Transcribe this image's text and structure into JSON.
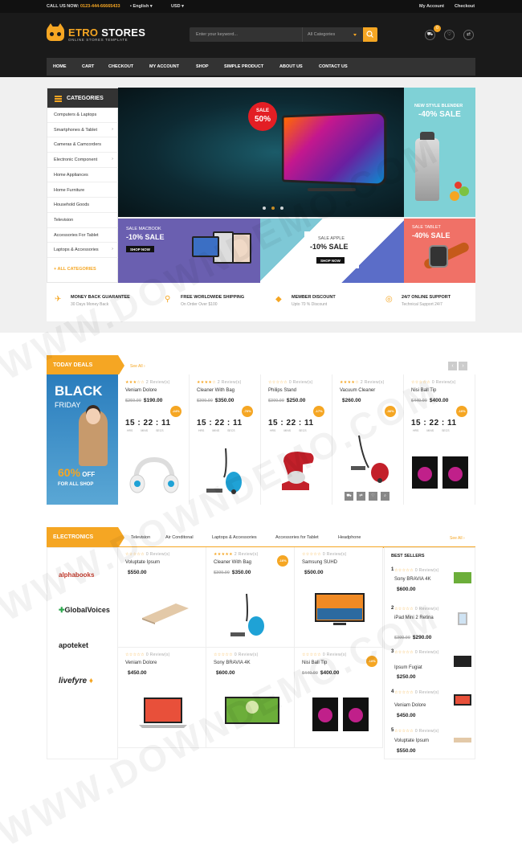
{
  "topbar": {
    "call": "CALL US NOW:",
    "phone": "0123-444-66665433",
    "lang": "English",
    "currency": "USD",
    "account": "My Account",
    "checkout": "Checkout"
  },
  "logo": {
    "name1": "ETRO",
    "name2": " STORES",
    "tagline": "ONLINE STORES TEMPLATE"
  },
  "search": {
    "placeholder": "Enter your keyword...",
    "category": "All Categories"
  },
  "cart": {
    "count": "0"
  },
  "nav": [
    "HOME",
    "CART",
    "CHECKOUT",
    "MY ACCOUNT",
    "SHOP",
    "SIMPLE PRODUCT",
    "ABOUT US",
    "CONTACT US"
  ],
  "categories": {
    "title": "CATEGORIES",
    "items": [
      {
        "label": "Computers & Laptops",
        "arrow": ""
      },
      {
        "label": "Smartphones & Tablet",
        "arrow": "›"
      },
      {
        "label": "Cameras & Camcorders",
        "arrow": ""
      },
      {
        "label": "Electronic Component",
        "arrow": "›"
      },
      {
        "label": "Home Appliances",
        "arrow": ""
      },
      {
        "label": "Home Furniture",
        "arrow": ""
      },
      {
        "label": "Household Goods",
        "arrow": ""
      },
      {
        "label": "Television",
        "arrow": ""
      },
      {
        "label": "Accessories For Tablet",
        "arrow": ""
      },
      {
        "label": "Laptops & Accessories",
        "arrow": "›"
      }
    ],
    "all": "ALL CATEGORIES"
  },
  "slider": {
    "sale_top": "SALE",
    "sale_pct": "50%"
  },
  "banners": {
    "b1_t1": "NEW STYLE BLENDER",
    "b1_t2": "-40% SALE",
    "b2_t1": "SALE MACBOOK",
    "b2_t2": "-10% SALE",
    "b2_btn": "SHOP NOW",
    "b3_t1": "SALE APPLE",
    "b3_t2": "-10% SALE",
    "b3_btn": "SHOP NOW",
    "b4_t1": "SALE TABLET",
    "b4_t2": "-40% SALE"
  },
  "features": [
    {
      "icon": "✈",
      "t1": "MONEY BACK GUARANTEE",
      "t2": "30 Days Money Back"
    },
    {
      "icon": "⚲",
      "t1": "FREE WORLDWIDE SHIPPING",
      "t2": "On Order Over $100"
    },
    {
      "icon": "◆",
      "t1": "MEMBER DISCOUNT",
      "t2": "Upto 70 % Discount"
    },
    {
      "icon": "◎",
      "t1": "24/7 ONLINE SUPPORT",
      "t2": "Technical Support 24/7"
    }
  ],
  "deals": {
    "title": "TODAY DEALS",
    "see_all": "See All ›",
    "banner": {
      "l1": "BLACK",
      "l2": "FRIDAY",
      "pct": "60%",
      "off": " OFF",
      "shop": "FOR ALL SHOP"
    },
    "items": [
      {
        "stars": "★★★☆☆",
        "reviews": "2 Review(s)",
        "name": "Veniam Dolore",
        "old": "$250.00",
        "price": "$190.00",
        "time": "15 : 22 : 11",
        "labels": "HRS MINS SECS",
        "disc": "-24%"
      },
      {
        "stars": "★★★★☆",
        "reviews": "2 Review(s)",
        "name": "Cleaner With Bag",
        "old": "$300.00",
        "price": "$350.00",
        "time": "15 : 22 : 11",
        "labels": "HRS MINS SECS",
        "disc": "-76%"
      },
      {
        "stars": "☆☆☆☆☆",
        "reviews": "0 Review(s)",
        "name": "Philips Stand",
        "old": "$300.00",
        "price": "$250.00",
        "time": "15 : 22 : 11",
        "labels": "HRS MINS SECS",
        "disc": "-17%"
      },
      {
        "stars": "★★★★☆",
        "reviews": "2 Review(s)",
        "name": "Vacuum Cleaner",
        "old": "",
        "price": "$260.00",
        "time": "",
        "labels": "",
        "disc": "-36%"
      },
      {
        "stars": "☆☆☆☆☆",
        "reviews": "0 Review(s)",
        "name": "Nisi Ball Tip",
        "old": "$440.00",
        "price": "$400.00",
        "time": "15 : 22 : 11",
        "labels": "HRS MINS SECS",
        "disc": "-10%"
      }
    ]
  },
  "electronics": {
    "title": "ELECTRONICS",
    "tabs": [
      "Television",
      "Air Conditonal",
      "Laptops & Accessories",
      "Accessories for Tablet",
      "Headphone"
    ],
    "see_all": "See All ›",
    "brands": [
      "alphabooks",
      "GlobalVoices",
      "apoteket",
      "livefyre"
    ],
    "products": [
      {
        "stars": "☆☆☆☆☆",
        "reviews": "0 Review(s)",
        "name": "Voluptate Ipsum",
        "old": "",
        "price": "$550.00",
        "disc": ""
      },
      {
        "stars": "★★★★★",
        "reviews": "2 Review(s)",
        "name": "Cleaner With Bag",
        "old": "$300.00",
        "price": "$350.00",
        "disc": "-16%"
      },
      {
        "stars": "☆☆☆☆☆",
        "reviews": "0 Review(s)",
        "name": "Samsung SUHD",
        "old": "",
        "price": "$500.00",
        "disc": ""
      },
      {
        "stars": "☆☆☆☆☆",
        "reviews": "0 Review(s)",
        "name": "Veniam Dolore",
        "old": "",
        "price": "$450.00",
        "disc": ""
      },
      {
        "stars": "☆☆☆☆☆",
        "reviews": "0 Review(s)",
        "name": "Sony BRAVIA 4K",
        "old": "",
        "price": "$600.00",
        "disc": ""
      },
      {
        "stars": "☆☆☆☆☆",
        "reviews": "0 Review(s)",
        "name": "Nisi Ball Tip",
        "old": "$440.00",
        "price": "$400.00",
        "disc": "-10%"
      }
    ],
    "bestsellers": {
      "title": "BEST SELLERS",
      "items": [
        {
          "num": "1",
          "stars": "☆☆☆☆☆",
          "reviews": "0 Review(s)",
          "name": "Sony BRAVIA 4K",
          "price": "$600.00",
          "old": ""
        },
        {
          "num": "2",
          "stars": "☆☆☆☆☆",
          "reviews": "0 Review(s)",
          "name": "iPad Mini 2 Retina",
          "price": "$290.00",
          "old": "$300.00"
        },
        {
          "num": "3",
          "stars": "☆☆☆☆☆",
          "reviews": "0 Review(s)",
          "name": "Ipsum Fugiat",
          "price": "$250.00",
          "old": ""
        },
        {
          "num": "4",
          "stars": "☆☆☆☆☆",
          "reviews": "0 Review(s)",
          "name": "Veniam Dolore",
          "price": "$450.00",
          "old": ""
        },
        {
          "num": "5",
          "stars": "☆☆☆☆☆",
          "reviews": "0 Review(s)",
          "name": "Voluptate Ipsum",
          "price": "$550.00",
          "old": ""
        }
      ]
    }
  },
  "watermark": "WWW.DOWNDEMO.COM",
  "colors": {
    "accent": "#f5a623",
    "dark": "#1a1a1a"
  }
}
